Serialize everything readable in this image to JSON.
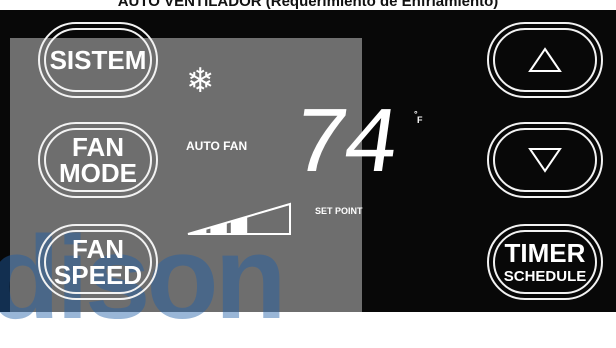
{
  "header": {
    "caption": "AUTO VENTILADOR (Requerimiento de Enfriamiento)"
  },
  "watermark": {
    "text": "dison"
  },
  "buttons": {
    "system": {
      "line1": "SISTEM"
    },
    "fan_mode": {
      "line1": "FAN",
      "line2": "MODE"
    },
    "fan_speed": {
      "line1": "FAN",
      "line2": "SPEED"
    },
    "up": {
      "icon": "triangle-up-icon"
    },
    "down": {
      "icon": "triangle-down-icon"
    },
    "timer_schedule": {
      "line1": "TIMER",
      "line2": "SCHEDULE"
    }
  },
  "display": {
    "mode_icon": "❄",
    "fan_status": "AUTO FAN",
    "temperature": "74",
    "unit": "F",
    "unit_degree": "°",
    "setpoint_label": "SET POINT",
    "fan_speed_level": 0.6
  },
  "colors": {
    "panel": "#080808",
    "lcd": "#6e6e6e",
    "text": "#ffffff",
    "watermark": "#1f5fa8"
  }
}
